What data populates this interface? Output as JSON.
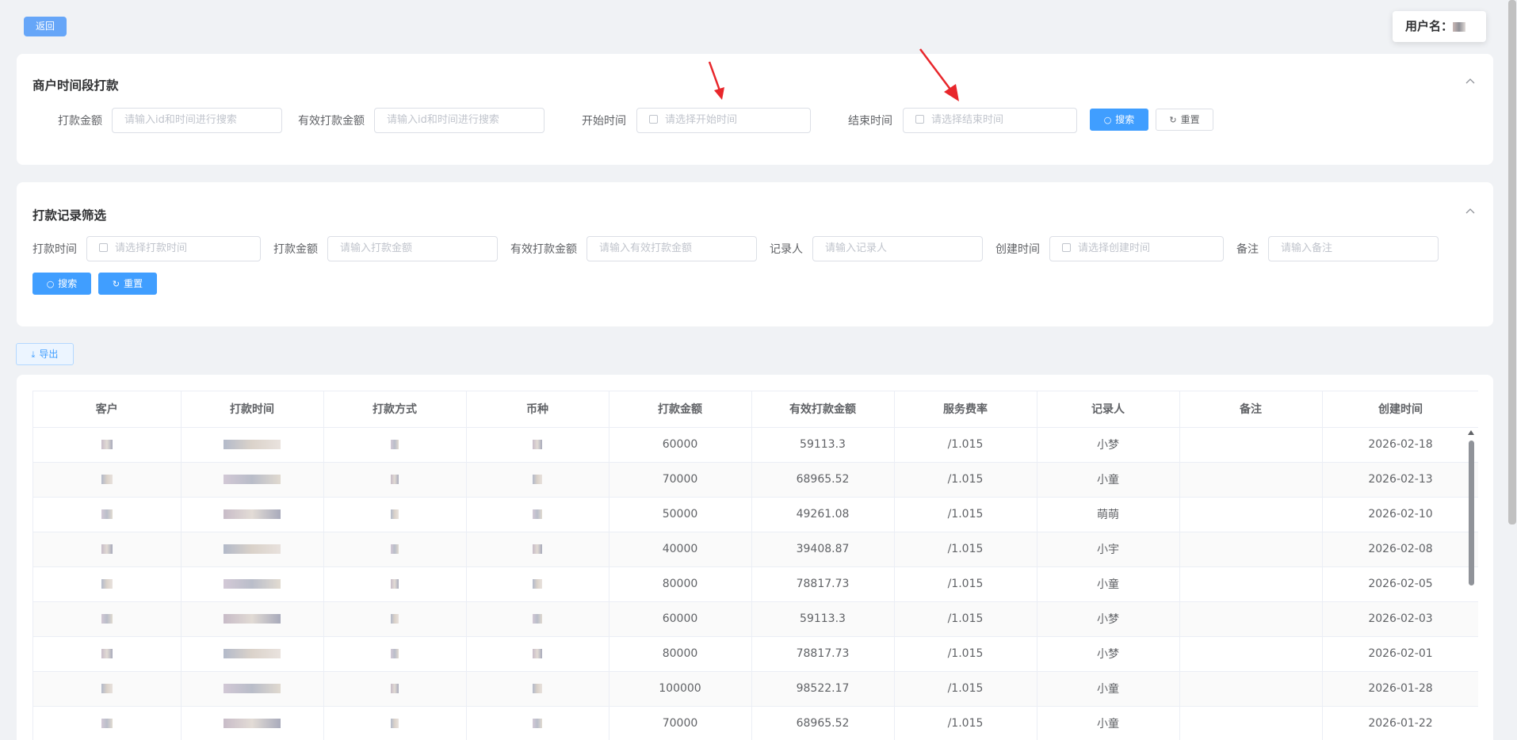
{
  "header": {
    "back_label": "返回",
    "user_label": "用户名："
  },
  "merchant_section": {
    "title": "商户时间段打款",
    "fields": {
      "amount_label": "打款金额",
      "amount_placeholder": "请输入id和时间进行搜索",
      "valid_amount_label": "有效打款金额",
      "valid_amount_placeholder": "请输入id和时间进行搜索",
      "start_label": "开始时间",
      "start_placeholder": "请选择开始时间",
      "end_label": "结束时间",
      "end_placeholder": "请选择结束时间"
    },
    "search_label": "搜索",
    "reset_label": "重置"
  },
  "filter_section": {
    "title": "打款记录筛选",
    "fields": {
      "time_label": "打款时间",
      "time_placeholder": "请选择打款时间",
      "amount_label": "打款金额",
      "amount_placeholder": "请输入打款金额",
      "valid_amount_label": "有效打款金额",
      "valid_amount_placeholder": "请输入有效打款金额",
      "recorder_label": "记录人",
      "recorder_placeholder": "请输入记录人",
      "created_label": "创建时间",
      "created_placeholder": "请选择创建时间",
      "remark_label": "备注",
      "remark_placeholder": "请输入备注"
    },
    "search_label": "搜索",
    "reset_label": "重置"
  },
  "export_label": "导出",
  "table": {
    "columns": [
      "客户",
      "打款时间",
      "打款方式",
      "币种",
      "打款金额",
      "有效打款金额",
      "服务费率",
      "记录人",
      "备注",
      "创建时间"
    ],
    "rows": [
      {
        "amount": "60000",
        "valid": "59113.3",
        "rate": "/1.015",
        "recorder": "小梦",
        "remark": "",
        "created": "2026-02-18"
      },
      {
        "amount": "70000",
        "valid": "68965.52",
        "rate": "/1.015",
        "recorder": "小童",
        "remark": "",
        "created": "2026-02-13"
      },
      {
        "amount": "50000",
        "valid": "49261.08",
        "rate": "/1.015",
        "recorder": "萌萌",
        "remark": "",
        "created": "2026-02-10"
      },
      {
        "amount": "40000",
        "valid": "39408.87",
        "rate": "/1.015",
        "recorder": "小宇",
        "remark": "",
        "created": "2026-02-08"
      },
      {
        "amount": "80000",
        "valid": "78817.73",
        "rate": "/1.015",
        "recorder": "小童",
        "remark": "",
        "created": "2026-02-05"
      },
      {
        "amount": "60000",
        "valid": "59113.3",
        "rate": "/1.015",
        "recorder": "小梦",
        "remark": "",
        "created": "2026-02-03"
      },
      {
        "amount": "80000",
        "valid": "78817.73",
        "rate": "/1.015",
        "recorder": "小梦",
        "remark": "",
        "created": "2026-02-01"
      },
      {
        "amount": "100000",
        "valid": "98522.17",
        "rate": "/1.015",
        "recorder": "小童",
        "remark": "",
        "created": "2026-01-28"
      },
      {
        "amount": "70000",
        "valid": "68965.52",
        "rate": "/1.015",
        "recorder": "小童",
        "remark": "",
        "created": "2026-01-22"
      }
    ]
  },
  "colors": {
    "primary": "#409eff",
    "annotation_arrow": "#e8262b"
  }
}
